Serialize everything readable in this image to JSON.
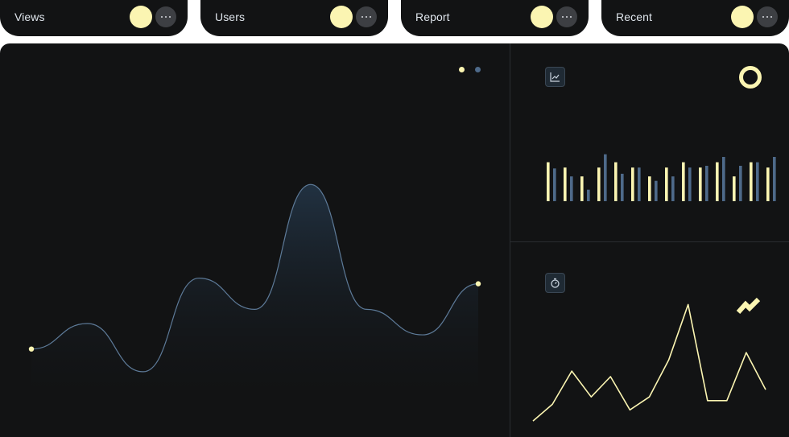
{
  "tabs": [
    {
      "label": "Views"
    },
    {
      "label": "Users"
    },
    {
      "label": "Report"
    },
    {
      "label": "Recent"
    }
  ],
  "icons": {
    "tab_dot": "yellow-circle",
    "tab_more": "ellipsis-icon",
    "bar_card": "trend-chart-icon",
    "line_card": "stopwatch-icon",
    "ring": "ring-icon",
    "zigzag": "zigzag-icon"
  },
  "colors": {
    "background": "#121314",
    "accent_yellow": "#fbf5b2",
    "accent_blue": "#4e6a8a",
    "area_line": "#5d7a98"
  },
  "chart_data": [
    {
      "type": "area",
      "x": [
        0,
        1,
        2,
        3,
        4,
        5,
        6,
        7,
        8
      ],
      "values": [
        12,
        21,
        4,
        37,
        26,
        70,
        26,
        17,
        35
      ],
      "ylim": [
        0,
        80
      ],
      "legend": [
        "yellow",
        "blue"
      ],
      "grid": false
    },
    {
      "type": "bar",
      "series": [
        {
          "color": "#fbf5b2",
          "values": [
            44,
            38,
            28,
            38,
            44,
            38,
            28,
            38,
            44,
            38,
            44,
            28,
            44,
            38
          ]
        },
        {
          "color": "#4e6a8a",
          "values": [
            37,
            28,
            13,
            53,
            31,
            38,
            23,
            28,
            38,
            40,
            50,
            40,
            44,
            50
          ]
        }
      ],
      "ylim": [
        0,
        60
      ]
    },
    {
      "type": "line",
      "x": [
        0,
        1,
        2,
        3,
        4,
        5,
        6,
        7,
        8,
        9,
        10,
        11,
        12,
        13
      ],
      "values": [
        3,
        12,
        30,
        16,
        27,
        9,
        16,
        36,
        66,
        14,
        14,
        40,
        20
      ],
      "ylim": [
        0,
        70
      ]
    }
  ]
}
